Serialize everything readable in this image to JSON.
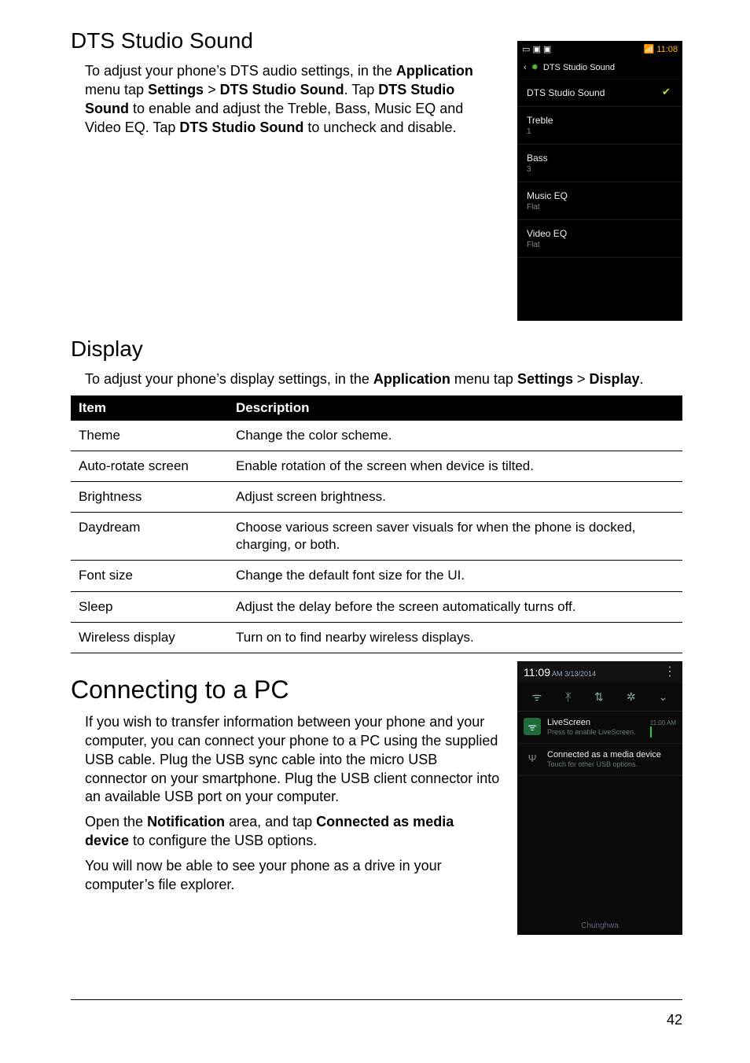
{
  "section1": {
    "heading": "DTS Studio Sound",
    "para_parts": [
      "To adjust your phone’s DTS audio settings, in the ",
      "Application",
      " menu tap ",
      "Settings",
      " > ",
      "DTS Studio Sound",
      ". Tap ",
      "DTS Studio Sound",
      " to enable and adjust the Treble, Bass, Music EQ and Video EQ. Tap ",
      "DTS Studio Sound",
      " to uncheck and disable."
    ]
  },
  "phone1": {
    "status_left": "▭ ▣ ▣",
    "status_right_signal": "📶",
    "status_right_time": "11:08",
    "appbar_back": "‹",
    "appbar_gear": "✸",
    "appbar_title": "DTS Studio Sound",
    "item_enable": "DTS Studio Sound",
    "item_enable_check": "✔",
    "treble_label": "Treble",
    "treble_val": "1",
    "bass_label": "Bass",
    "bass_val": "3",
    "musiceq_label": "Music EQ",
    "musiceq_val": "Flat",
    "videoeq_label": "Video EQ",
    "videoeq_val": "Flat"
  },
  "section2": {
    "heading": "Display",
    "para_parts": [
      "To adjust your phone’s display settings, in the ",
      "Application",
      " menu tap ",
      "Settings",
      " > ",
      "Display",
      "."
    ]
  },
  "table": {
    "head_item": "Item",
    "head_desc": "Description",
    "rows": [
      {
        "item": "Theme",
        "desc": "Change the color scheme."
      },
      {
        "item": "Auto-rotate screen",
        "desc": "Enable rotation of the screen when device is tilted."
      },
      {
        "item": "Brightness",
        "desc": "Adjust screen brightness."
      },
      {
        "item": "Daydream",
        "desc": "Choose various screen saver visuals for when the phone is docked, charging, or both."
      },
      {
        "item": "Font size",
        "desc": "Change the default font size for the UI."
      },
      {
        "item": "Sleep",
        "desc": "Adjust the delay before the screen automatically turns off."
      },
      {
        "item": "Wireless display",
        "desc": "Turn on to find nearby wireless displays."
      }
    ]
  },
  "section3": {
    "heading": "Connecting to a PC",
    "para1": "If you wish to transfer information between your phone and your computer, you can connect your phone to a PC using the supplied USB cable. Plug the USB sync cable into the micro USB connector on your smartphone. Plug the USB client connector into an available USB port on your computer.",
    "para2_parts": [
      "Open the ",
      "Notification",
      " area, and tap ",
      "Connected as media device",
      " to configure the USB options."
    ],
    "para3": "You will now be able to see your phone as a drive in your computer’s file explorer."
  },
  "phone2": {
    "time": "11:09",
    "ampm": "AM 3/13/2014",
    "menu": "⋮",
    "quick": {
      "wifi": "ᯤ",
      "bt": "ᛡ",
      "sync": "⇅",
      "bright": "✲",
      "more": "⌄"
    },
    "notif1": {
      "icon": "ᯤ",
      "title": "LiveScreen",
      "sub": "Press to enable LiveScreen.",
      "meta": "11:00 AM",
      "thumb": "▣"
    },
    "notif2": {
      "icon": "Ψ",
      "title": "Connected as a media device",
      "sub": "Touch for other USB options."
    },
    "carrier": "Chunghwa"
  },
  "page_number": "42"
}
